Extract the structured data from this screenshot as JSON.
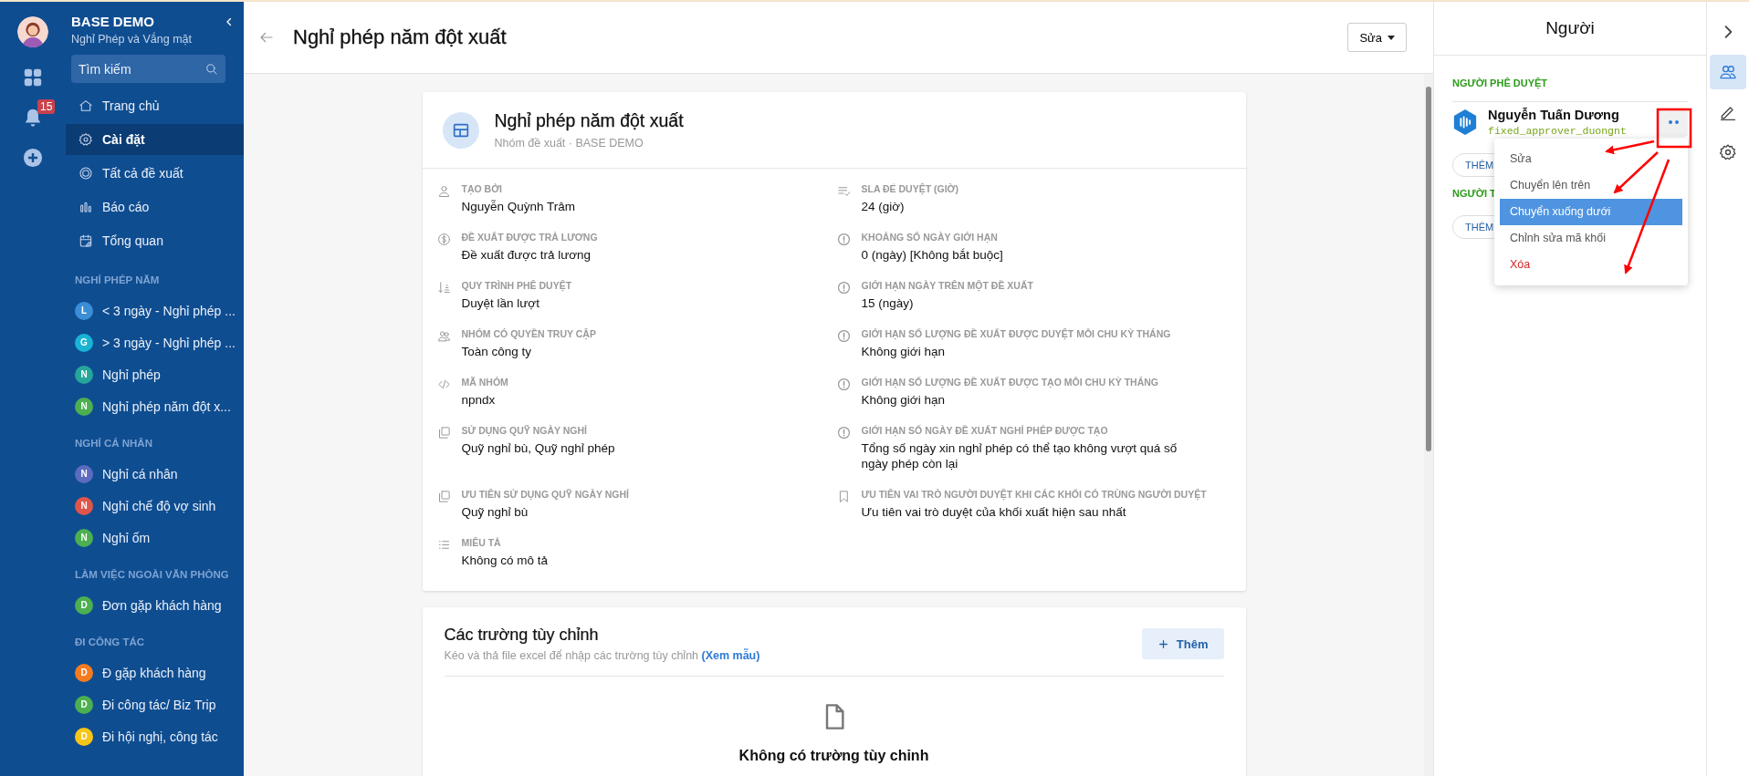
{
  "sidebar": {
    "title": "BASE DEMO",
    "subtitle": "Nghỉ Phép và Vắng mặt",
    "notification_count": "15",
    "search": {
      "placeholder": "Tìm kiếm"
    },
    "nav": [
      {
        "label": "Trang chủ",
        "selected": false
      },
      {
        "label": "Cài đặt",
        "selected": true
      },
      {
        "label": "Tất cả đề xuất",
        "selected": false
      },
      {
        "label": "Báo cáo",
        "selected": false
      },
      {
        "label": "Tổng quan",
        "selected": false
      }
    ],
    "groups": [
      {
        "heading": "NGHỈ PHÉP NĂM",
        "items": [
          {
            "letter": "L",
            "label": "< 3 ngày - Nghỉ phép ...",
            "color": "#3b8ed6"
          },
          {
            "letter": "G",
            "label": "> 3 ngày - Nghỉ phép ...",
            "color": "#19b3d3"
          },
          {
            "letter": "N",
            "label": "Nghỉ phép",
            "color": "#26a69a"
          },
          {
            "letter": "N",
            "label": "Nghỉ phép năm đột x...",
            "color": "#4caf50"
          }
        ]
      },
      {
        "heading": "NGHỈ CÁ NHÂN",
        "items": [
          {
            "letter": "N",
            "label": "Nghỉ cá nhân",
            "color": "#5c6bc0"
          },
          {
            "letter": "N",
            "label": "Nghỉ chế độ vợ sinh",
            "color": "#e0554a"
          },
          {
            "letter": "N",
            "label": "Nghỉ ốm",
            "color": "#4caf50"
          }
        ]
      },
      {
        "heading": "LÀM VIỆC NGOÀI VĂN PHÒNG",
        "items": [
          {
            "letter": "D",
            "label": "Đơn gặp khách hàng",
            "color": "#4caf50"
          }
        ]
      },
      {
        "heading": "ĐI CÔNG TÁC",
        "items": [
          {
            "letter": "D",
            "label": "Đ gặp khách hàng",
            "color": "#f47b20"
          },
          {
            "letter": "D",
            "label": "Đi công tác/ Biz Trip",
            "color": "#4caf50"
          },
          {
            "letter": "D",
            "label": "Đi hội nghị, công tác",
            "color": "#f5c518"
          }
        ]
      }
    ]
  },
  "header": {
    "title": "Nghỉ phép năm đột xuất",
    "edit_button": "Sửa"
  },
  "card": {
    "title": "Nghỉ phép năm đột xuất",
    "subtitle": "Nhóm đề xuất · BASE DEMO",
    "left_fields": [
      {
        "label": "TẠO BỞI",
        "value": "Nguyễn Quỳnh Trâm"
      },
      {
        "label": "ĐỀ XUẤT ĐƯỢC TRẢ LƯƠNG",
        "value": "Đề xuất được trả lương"
      },
      {
        "label": "QUY TRÌNH PHÊ DUYỆT",
        "value": "Duyệt lần lượt"
      },
      {
        "label": "NHÓM CÓ QUYỀN TRUY CẬP",
        "value": "Toàn công ty"
      },
      {
        "label": "MÃ NHÓM",
        "value": "npndx"
      },
      {
        "label": "SỬ DỤNG QUỸ NGÀY NGHỈ",
        "value": "Quỹ nghỉ bù, Quỹ nghỉ phép"
      },
      {
        "label": "ƯU TIÊN SỬ DỤNG QUỸ NGÀY NGHỈ",
        "value": "Quỹ nghỉ bù"
      },
      {
        "label": "MIÊU TẢ",
        "value": "Không có mô tả"
      }
    ],
    "right_fields": [
      {
        "label": "SLA ĐỂ DUYỆT (GIỜ)",
        "value": "24 (giờ)"
      },
      {
        "label": "KHOẢNG SỐ NGÀY GIỚI HẠN",
        "value": "0 (ngày) [Không bắt buộc]"
      },
      {
        "label": "GIỚI HẠN NGÀY TRÊN MỘT ĐỀ XUẤT",
        "value": "15 (ngày)"
      },
      {
        "label": "GIỚI HẠN SỐ LƯỢNG ĐỀ XUẤT ĐƯỢC DUYỆT MỖI CHU KỲ THÁNG",
        "value": "Không giới hạn"
      },
      {
        "label": "GIỚI HẠN SỐ LƯỢNG ĐỀ XUẤT ĐƯỢC TẠO MỖI CHU KỲ THÁNG",
        "value": "Không giới hạn"
      },
      {
        "label": "GIỚI HẠN SỐ NGÀY ĐỀ XUẤT NGHỈ PHÉP ĐƯỢC TẠO",
        "value": "Tổng số ngày xin nghỉ phép có thể tạo không vượt quá số ngày phép còn lại"
      },
      {
        "label": "ƯU TIÊN VAI TRÒ NGƯỜI DUYỆT KHI CÁC KHỐI CÓ TRÙNG NGƯỜI DUYỆT",
        "value": "Ưu tiên vai trò duyệt của khối xuất hiện sau nhất"
      }
    ]
  },
  "custom_fields": {
    "title": "Các trường tùy chỉnh",
    "hint": "Kéo và thả file excel để nhập các trường tùy chỉnh",
    "link": "(Xem mẫu)",
    "add_button": "Thêm",
    "empty": "Không có trường tùy chỉnh"
  },
  "people_panel": {
    "title": "Người",
    "sections": [
      {
        "heading": "NGƯỜI PHÊ DUYỆT",
        "approvers": [
          {
            "name": "Nguyễn Tuấn Dương",
            "code": "fixed_approver_duongnt"
          }
        ],
        "add_button": "THÊM"
      },
      {
        "heading": "NGƯỜI T",
        "add_button": "THÊM"
      }
    ],
    "menu": [
      {
        "label": "Sửa",
        "selected": false,
        "kind": "normal"
      },
      {
        "label": "Chuyển lên trên",
        "selected": false,
        "kind": "normal"
      },
      {
        "label": "Chuyển xuống dưới",
        "selected": true,
        "kind": "normal"
      },
      {
        "label": "Chỉnh sửa mã khối",
        "selected": false,
        "kind": "normal"
      },
      {
        "label": "Xóa",
        "selected": false,
        "kind": "danger"
      }
    ]
  },
  "right_rail": [
    {
      "selected": false
    },
    {
      "selected": true
    },
    {
      "selected": false
    },
    {
      "selected": false
    }
  ]
}
